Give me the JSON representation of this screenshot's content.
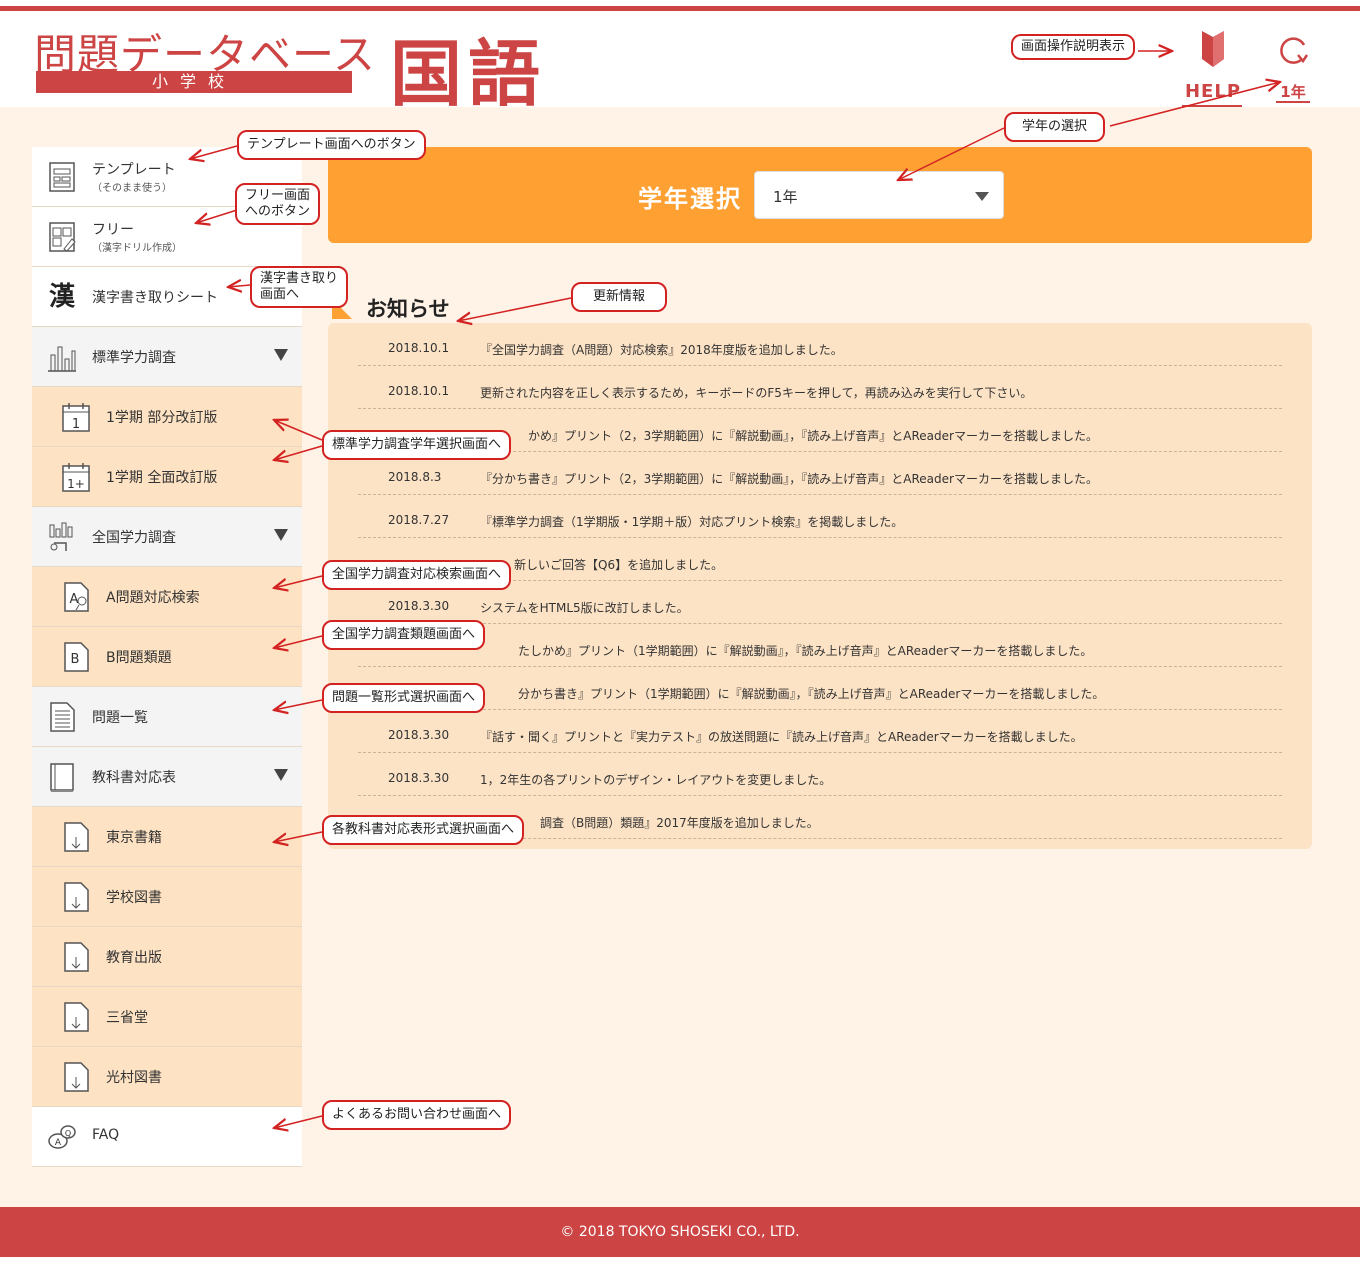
{
  "header": {
    "logo_title": "問題データベース",
    "logo_sub": "小学校",
    "subject": "国語",
    "help_label": "HELP",
    "grade_label": "1年"
  },
  "sidebar": {
    "items": [
      {
        "label": "テンプレート",
        "sublabel": "（そのまま使う）",
        "icon": "template-icon"
      },
      {
        "label": "フリー",
        "sublabel": "（漢字ドリル作成）",
        "icon": "free-icon"
      },
      {
        "label": "漢字書き取りシート",
        "icon": "kanji-icon",
        "glyph": "漢"
      },
      {
        "label": "標準学力調査",
        "icon": "bar-chart-icon"
      },
      {
        "label": "1学期 部分改訂版",
        "icon": "calendar-1-icon",
        "glyph": "1"
      },
      {
        "label": "1学期 全面改訂版",
        "icon": "calendar-1plus-icon",
        "glyph": "1+"
      },
      {
        "label": "全国学力調査",
        "icon": "national-chart-icon"
      },
      {
        "label": "A問題対応検索",
        "icon": "a-search-icon",
        "glyph": "A"
      },
      {
        "label": "B問題類題",
        "icon": "b-doc-icon",
        "glyph": "B"
      },
      {
        "label": "問題一覧",
        "icon": "list-doc-icon"
      },
      {
        "label": "教科書対応表",
        "icon": "textbook-icon"
      },
      {
        "label": "東京書籍",
        "icon": "download-doc-icon"
      },
      {
        "label": "学校図書",
        "icon": "download-doc-icon"
      },
      {
        "label": "教育出版",
        "icon": "download-doc-icon"
      },
      {
        "label": "三省堂",
        "icon": "download-doc-icon"
      },
      {
        "label": "光村図書",
        "icon": "download-doc-icon"
      },
      {
        "label": "FAQ",
        "icon": "faq-icon"
      }
    ]
  },
  "grade_panel": {
    "title": "学年選択",
    "selected": "1年"
  },
  "news": {
    "title": "お知らせ",
    "rows": [
      {
        "date": "2018.10.1",
        "text": "『全国学力調査（A問題）対応検索』2018年度版を追加しました。"
      },
      {
        "date": "2018.10.1",
        "text": "更新された内容を正しく表示するため，キーボードのF5キーを押して，再読み込みを実行して下さい。"
      },
      {
        "date": "",
        "text": "かめ』プリント（2，3学期範囲）に『解説動画』，『読み上げ音声』とAReaderマーカーを搭載しました。"
      },
      {
        "date": "2018.8.3",
        "text": "『分かち書き』プリント（2，3学期範囲）に『解説動画』，『読み上げ音声』とAReaderマーカーを搭載しました。"
      },
      {
        "date": "2018.7.27",
        "text": "『標準学力調査（1学期版・1学期＋版）対応プリント検索』を掲載しました。"
      },
      {
        "date": "",
        "text": "新しいご回答【Q6】を追加しました。"
      },
      {
        "date": "2018.3.30",
        "text": "システムをHTML5版に改訂しました。"
      },
      {
        "date": "",
        "text": "たしかめ』プリント（1学期範囲）に『解説動画』，『読み上げ音声』とAReaderマーカーを搭載しました。"
      },
      {
        "date": "",
        "text": "分かち書き』プリント（1学期範囲）に『解説動画』，『読み上げ音声』とAReaderマーカーを搭載しました。"
      },
      {
        "date": "2018.3.30",
        "text": "『話す・聞く』プリントと『実力テスト』の放送問題に『読み上げ音声』とAReaderマーカーを搭載しました。"
      },
      {
        "date": "2018.3.30",
        "text": "1，2年生の各プリントのデザイン・レイアウトを変更しました。"
      },
      {
        "date": "",
        "text": "調査（B問題）類題』2017年度版を追加しました。"
      }
    ]
  },
  "callouts": {
    "help": "画面操作説明表示",
    "grade": "学年の選択",
    "template": "テンプレート画面へのボタン",
    "free_1": "フリー画面",
    "free_2": "へのボタン",
    "kanji_1": "漢字書き取り",
    "kanji_2": "画面へ",
    "news": "更新情報",
    "standard": "標準学力調査学年選択画面へ",
    "national_a": "全国学力調査対応検索画面へ",
    "national_b": "全国学力調査類題画面へ",
    "list": "問題一覧形式選択画面へ",
    "textbook": "各教科書対応表形式選択画面へ",
    "faq": "よくあるお問い合わせ画面へ"
  },
  "footer": {
    "copyright": "© 2018 TOKYO SHOSEKI CO., LTD."
  },
  "colors": {
    "brand_red": "#cc4444",
    "orange": "#ffa033",
    "panel_bg": "#fde3c6",
    "page_bg": "#fff2e6",
    "callout_red": "#d32222"
  }
}
